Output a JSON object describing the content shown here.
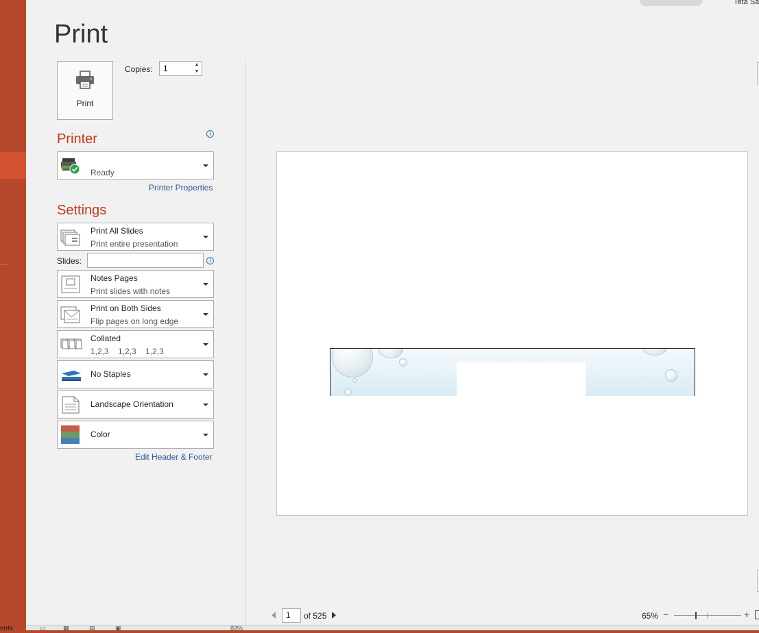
{
  "header": {
    "title": "Print",
    "user_name": "Teta Sa"
  },
  "print_button": {
    "label": "Print"
  },
  "copies": {
    "label": "Copies:",
    "value": "1"
  },
  "printer": {
    "section_title": "Printer",
    "status": "Ready",
    "properties_link": "Printer Properties"
  },
  "settings": {
    "section_title": "Settings",
    "slides_label": "Slides:",
    "slides_value": "",
    "dropdowns": [
      {
        "title": "Print All Slides",
        "subtitle": "Print entire presentation",
        "icon": "slides-stack-icon"
      },
      {
        "title": "Notes Pages",
        "subtitle": "Print slides with notes",
        "icon": "notes-page-icon"
      },
      {
        "title": "Print on Both Sides",
        "subtitle": "Flip pages on long edge",
        "icon": "duplex-icon"
      },
      {
        "title": "Collated",
        "subtitle": "1,2,3    1,2,3    1,2,3",
        "icon": "collated-icon"
      },
      {
        "title": "No Staples",
        "subtitle": "",
        "icon": "stapler-icon"
      },
      {
        "title": "Landscape Orientation",
        "subtitle": "",
        "icon": "landscape-icon"
      },
      {
        "title": "Color",
        "subtitle": "",
        "icon": "color-icon"
      }
    ],
    "header_footer_link": "Edit Header & Footer"
  },
  "preview_nav": {
    "current_page": "1",
    "of_text": "of 525"
  },
  "zoom": {
    "level": "65%",
    "minus": "−",
    "plus": "+"
  },
  "sidebar": {
    "strip_text": "ents"
  },
  "status_bar": {
    "zoom_text": "83%"
  },
  "colors": {
    "accent": "#b7472a",
    "accent_active": "#d35230",
    "section_heading": "#c5391a",
    "link": "#2b579a",
    "background": "#f1f1f1"
  }
}
